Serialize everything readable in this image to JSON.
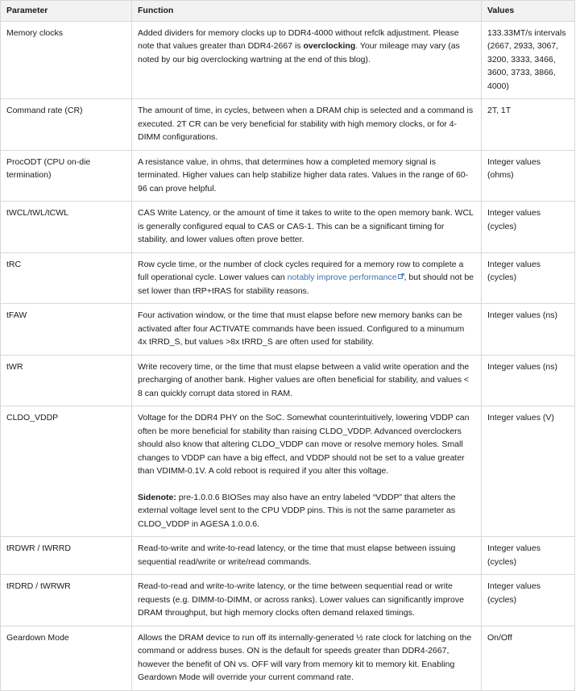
{
  "table": {
    "columns": [
      {
        "key": "parameter",
        "label": "Parameter"
      },
      {
        "key": "function",
        "label": "Function"
      },
      {
        "key": "values",
        "label": "Values"
      }
    ],
    "link_color": "#3b73af",
    "header_background": "#f2f2f2",
    "border_color": "#d8d8d8",
    "rows": [
      {
        "parameter": "Memory clocks",
        "function_pre": "Added dividers for memory clocks up to DDR4-4000 without refclk adjustment. Please note that values greater than DDR4-2667 is ",
        "function_bold": "overclocking",
        "function_post": ". Your mileage may vary (as noted by our big overclocking wartning at the end of this blog).",
        "values": "133.33MT/s intervals (2667, 2933, 3067, 3200, 3333, 3466, 3600, 3733, 3866, 4000)"
      },
      {
        "parameter": "Command rate (CR)",
        "function": "The amount of time, in cycles, between when a DRAM chip is selected and a command is executed. 2T CR can be very beneficial for stability with high memory clocks, or for 4-DIMM configurations.",
        "values": "2T, 1T"
      },
      {
        "parameter": "ProcODT (CPU on-die termination)",
        "function": "A resistance value, in ohms, that determines how a completed memory signal is terminated. Higher values can help stabilize higher data rates. Values in the range of 60-96 can prove helpful.",
        "values": "Integer values (ohms)"
      },
      {
        "parameter": "tWCL/tWL/tCWL",
        "function": "CAS Write Latency, or the amount of time it takes to write to the open memory bank. WCL is generally configured equal to CAS or CAS-1. This can be a significant timing for stability, and lower values often prove better.",
        "values": "Integer values (cycles)"
      },
      {
        "parameter": "tRC",
        "function_pre": "Row cycle time, or the number of clock cycles required for a memory row to complete a full operational cycle. Lower values can ",
        "link_text": "notably improve performance",
        "function_post": ", but should not be set lower than tRP+tRAS for stability reasons.",
        "values": "Integer values (cycles)"
      },
      {
        "parameter": "tFAW",
        "function": "Four activation window, or the time that must elapse before new memory banks can be activated after four ACTIVATE commands have been issued. Configured to a minumum 4x tRRD_S, but values >8x tRRD_S are often used for stability.",
        "values": "Integer values (ns)"
      },
      {
        "parameter": "tWR",
        "function": "Write recovery time, or the time that must elapse between a valid write operation and the precharging of another bank. Higher values are often beneficial for stability, and values < 8 can quickly corrupt data stored in RAM.",
        "values": "Integer values (ns)"
      },
      {
        "parameter": "CLDO_VDDP",
        "function": "Voltage for the DDR4 PHY on the SoC. Somewhat counterintuitively, lowering VDDP can often be more beneficial for stability than raising CLDO_VDDP. Advanced overclockers should also know that altering CLDO_VDDP can move or resolve memory holes. Small changes to VDDP can have a big effect, and VDDP should not be set to a value greater than VDIMM-0.1V. A cold reboot is required if you alter this voltage.",
        "sidenote_bold": "Sidenote:",
        "sidenote_text": " pre-1.0.0.6 BIOSes may also have an entry labeled “VDDP” that alters the external voltage level sent to the CPU VDDP pins. This is not the same parameter as CLDO_VDDP in AGESA 1.0.0.6.",
        "values": "Integer values (V)"
      },
      {
        "parameter": "tRDWR / tWRRD",
        "function": "Read-to-write and write-to-read latency, or the time that must elapse between issuing sequential read/write or write/read commands.",
        "values": "Integer values (cycles)"
      },
      {
        "parameter": "tRDRD / tWRWR",
        "function": "Read-to-read and write-to-write latency, or the time between sequential read or write requests (e.g. DIMM-to-DIMM, or across ranks). Lower values can significantly improve DRAM throughput, but high memory clocks often demand relaxed timings.",
        "values": "Integer values (cycles)"
      },
      {
        "parameter": "Geardown Mode",
        "function": "Allows the DRAM device to run off its internally-generated ½ rate clock for latching on the command or address buses. ON is the default for speeds greater than DDR4-2667, however the benefit of ON vs. OFF will vary from memory kit to memory kit. Enabling Geardown Mode will override your current command rate.",
        "values": "On/Off"
      }
    ]
  }
}
